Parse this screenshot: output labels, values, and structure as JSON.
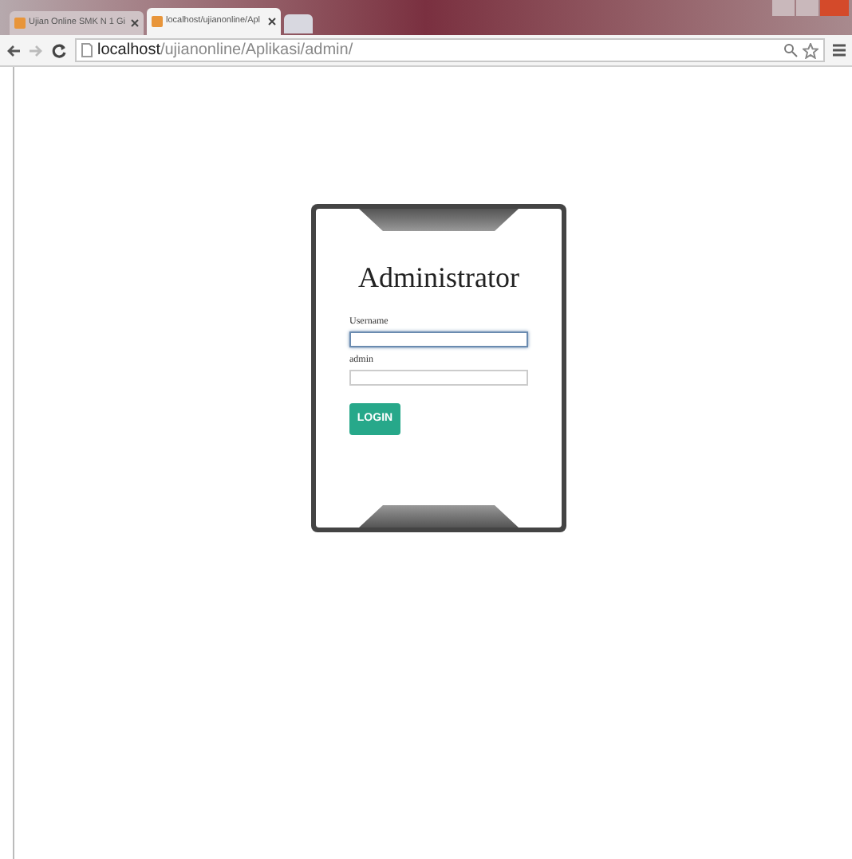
{
  "browser": {
    "tabs": [
      {
        "title": "Ujian Online SMK N 1 Gi",
        "selected": false
      },
      {
        "title": "localhost/ujianonline/Apl",
        "selected": true
      }
    ],
    "address": {
      "host": "localhost",
      "path": "/ujianonline/Aplikasi/admin/"
    }
  },
  "login": {
    "title": "Administrator",
    "fields": [
      {
        "label": "Username",
        "focused": true
      },
      {
        "label": "admin",
        "focused": false
      }
    ],
    "button": "LOGIN"
  }
}
